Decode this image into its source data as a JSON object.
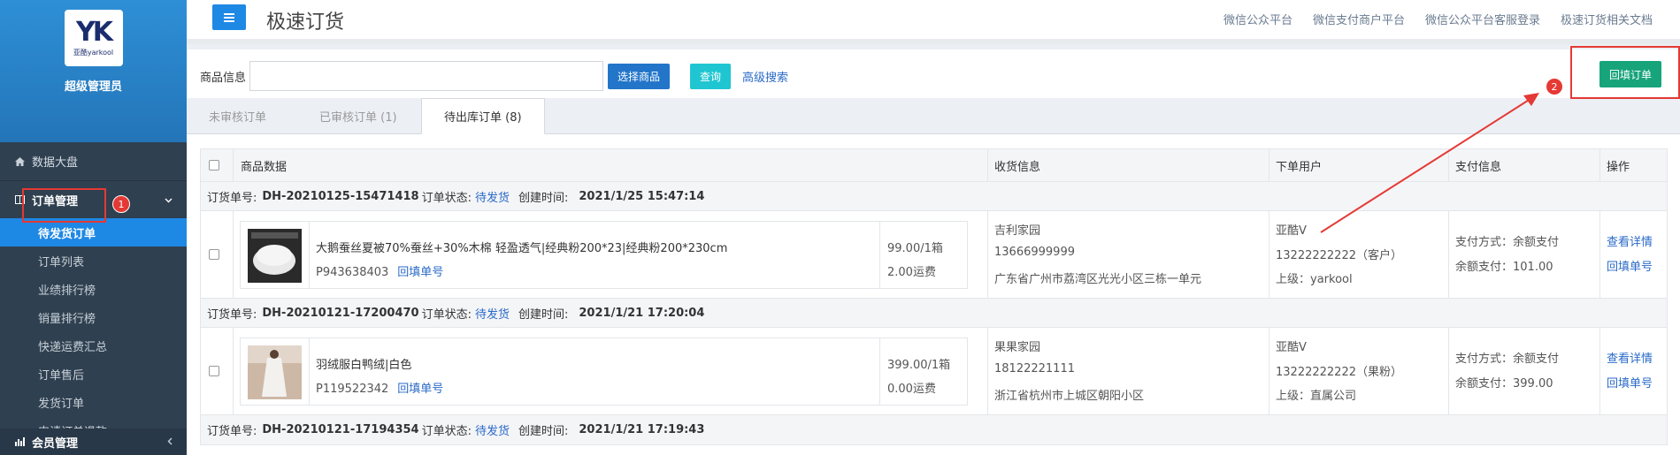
{
  "sidebar": {
    "logo_text": "亚酷yarkool",
    "admin_name": "超级管理员",
    "dashboard": "数据大盘",
    "order_section": "订单管理",
    "order_items": [
      "待发货订单",
      "订单列表",
      "业绩排行榜",
      "销量排行榜",
      "快递运费汇总",
      "订单售后",
      "发货订单",
      "申请订单退款"
    ],
    "member_section": "会员管理",
    "badge1": "1"
  },
  "header": {
    "page_title": "极速订货",
    "links": [
      "微信公众平台",
      "微信支付商户平台",
      "微信公众平台客服登录",
      "极速订货相关文档"
    ]
  },
  "search": {
    "label": "商品信息",
    "placeholder": "",
    "select_goods": "选择商品",
    "query": "查询",
    "advanced": "高级搜索",
    "backfill": "回填订单",
    "badge2": "2"
  },
  "tabs": [
    {
      "label": "未审核订单"
    },
    {
      "label": "已审核订单  (1)"
    },
    {
      "label": "待出库订单  (8)"
    }
  ],
  "table": {
    "headers": {
      "goods": "商品数据",
      "shipping": "收货信息",
      "user": "下单用户",
      "pay": "支付信息",
      "ops": "操作"
    },
    "order_no_label": "订货单号:",
    "status_label": "订单状态:",
    "created_label": "创建时间:",
    "orders": [
      {
        "no": "DH-20210125-15471418",
        "status": "待发货",
        "created": "2021/1/25 15:47:14",
        "goods_name": "大鹅蚕丝夏被70%蚕丝+30%木棉 轻盈透气|经典粉200*23|经典粉200*230cm",
        "sku": "P943638403",
        "sku_link": "回填单号",
        "price": "99.00/1箱",
        "ship": "2.00运费",
        "consignee": "吉利家园",
        "phone": "13666999999",
        "address": "广东省广州市荔湾区光光小区三栋一单元",
        "user": "亚酷V",
        "user_phone": "13222222222（客户）",
        "superior": "上级：yarkool",
        "pay_method": "支付方式：余额支付",
        "pay_amount": "余额支付：101.00",
        "op1": "查看详情",
        "op2": "回填单号"
      },
      {
        "no": "DH-20210121-17200470",
        "status": "待发货",
        "created": "2021/1/21 17:20:04",
        "goods_name": "羽绒服白鸭绒|白色",
        "sku": "P119522342",
        "sku_link": "回填单号",
        "price": "399.00/1箱",
        "ship": "0.00运费",
        "consignee": "果果家园",
        "phone": "18122221111",
        "address": "浙江省杭州市上城区朝阳小区",
        "user": "亚酷V",
        "user_phone": "13222222222（果粉）",
        "superior": "上级：直属公司",
        "pay_method": "支付方式：余额支付",
        "pay_amount": "余额支付：399.00",
        "op1": "查看详情",
        "op2": "回填单号"
      }
    ],
    "partial_order": {
      "no": "DH-20210121-17194354",
      "status": "待发货",
      "created": "2021/1/21 17:19:43"
    }
  },
  "colors": {
    "accent": "#1e88e5",
    "sidebar": "#2f4050",
    "green": "#17a47b",
    "annotation": "#e53935"
  }
}
